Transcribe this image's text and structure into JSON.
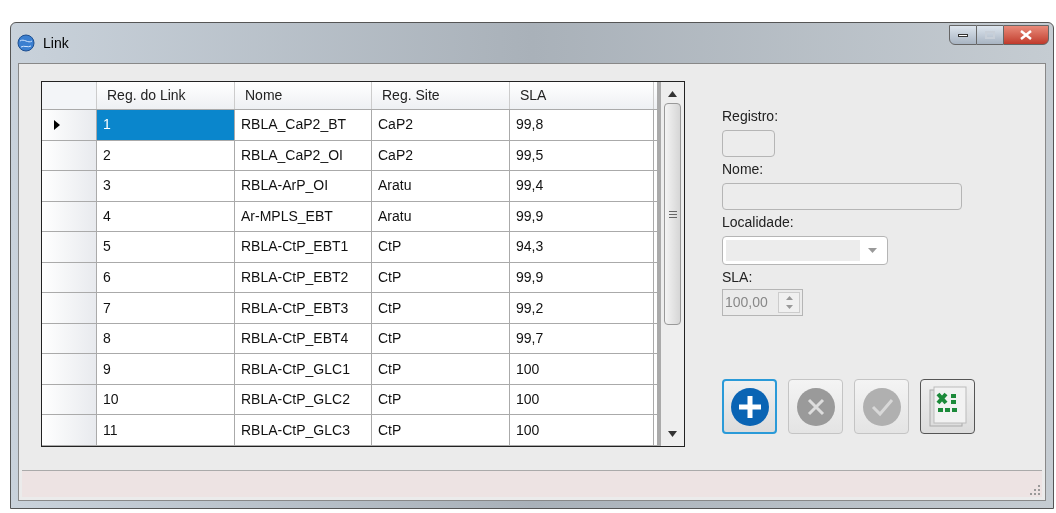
{
  "window": {
    "title": "Link"
  },
  "table": {
    "columns": [
      "Reg. do Link",
      "Nome",
      "Reg. Site",
      "SLA"
    ],
    "rows": [
      {
        "selected": true,
        "cells": [
          "1",
          "RBLA_CaP2_BT",
          "CaP2",
          "99,8"
        ]
      },
      {
        "selected": false,
        "cells": [
          "2",
          "RBLA_CaP2_OI",
          "CaP2",
          "99,5"
        ]
      },
      {
        "selected": false,
        "cells": [
          "3",
          "RBLA-ArP_OI",
          "Aratu",
          "99,4"
        ]
      },
      {
        "selected": false,
        "cells": [
          "4",
          "Ar-MPLS_EBT",
          "Aratu",
          "99,9"
        ]
      },
      {
        "selected": false,
        "cells": [
          "5",
          "RBLA-CtP_EBT1",
          "CtP",
          "94,3"
        ]
      },
      {
        "selected": false,
        "cells": [
          "6",
          "RBLA-CtP_EBT2",
          "CtP",
          "99,9"
        ]
      },
      {
        "selected": false,
        "cells": [
          "7",
          "RBLA-CtP_EBT3",
          "CtP",
          "99,2"
        ]
      },
      {
        "selected": false,
        "cells": [
          "8",
          "RBLA-CtP_EBT4",
          "CtP",
          "99,7"
        ]
      },
      {
        "selected": false,
        "cells": [
          "9",
          "RBLA-CtP_GLC1",
          "CtP",
          "100"
        ]
      },
      {
        "selected": false,
        "cells": [
          "10",
          "RBLA-CtP_GLC2",
          "CtP",
          "100"
        ]
      },
      {
        "selected": false,
        "cells": [
          "11",
          "RBLA-CtP_GLC3",
          "CtP",
          "100"
        ]
      }
    ]
  },
  "form": {
    "fields": [
      {
        "kind": "box",
        "label": "Registro:",
        "disabled": true
      },
      {
        "kind": "line",
        "label": "Nome:",
        "disabled": true
      },
      {
        "kind": "combo",
        "label": "Localidade:",
        "disabled": true
      },
      {
        "kind": "spin",
        "label": "SLA:",
        "value": "100,00",
        "disabled": true
      }
    ]
  },
  "buttons": [
    {
      "kind": "add",
      "disabled": false
    },
    {
      "kind": "cancel",
      "disabled": true
    },
    {
      "kind": "confirm",
      "disabled": true
    },
    {
      "kind": "excel",
      "disabled": false
    }
  ]
}
